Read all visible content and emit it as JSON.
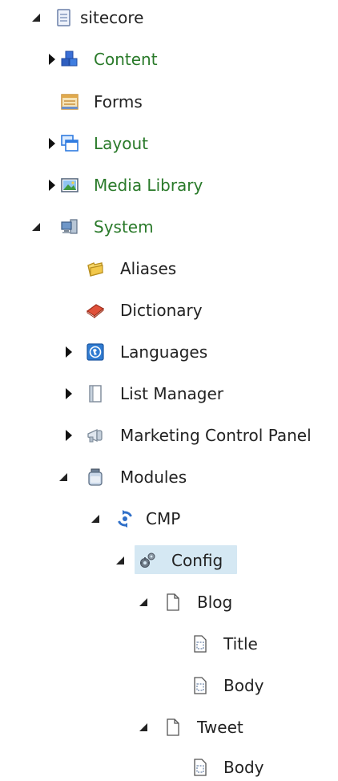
{
  "tree": {
    "items": [
      {
        "label": "sitecore"
      },
      {
        "label": "Content"
      },
      {
        "label": "Forms"
      },
      {
        "label": "Layout"
      },
      {
        "label": "Media Library"
      },
      {
        "label": "System"
      },
      {
        "label": "Aliases"
      },
      {
        "label": "Dictionary"
      },
      {
        "label": "Languages"
      },
      {
        "label": "List Manager"
      },
      {
        "label": "Marketing Control Panel"
      },
      {
        "label": "Modules"
      },
      {
        "label": "CMP"
      },
      {
        "label": "Config"
      },
      {
        "label": "Blog"
      },
      {
        "label": "Title"
      },
      {
        "label": "Body"
      },
      {
        "label": "Tweet"
      },
      {
        "label": "Body"
      }
    ]
  },
  "colors": {
    "link_green": "#2a7a2a",
    "text": "#222222",
    "selected_background": "#d5e8f3"
  }
}
